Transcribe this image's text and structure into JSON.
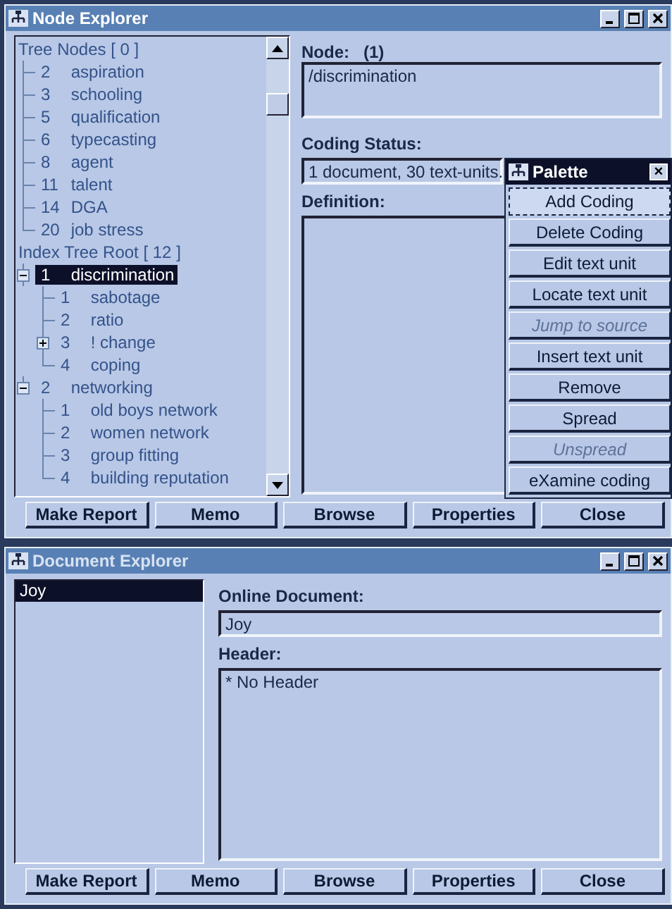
{
  "node_explorer": {
    "title": "Node Explorer",
    "tree": [
      {
        "label": "Tree Nodes [ 0 ]",
        "children": [
          {
            "number": "2",
            "label": "aspiration",
            "selected": false
          },
          {
            "number": "3",
            "label": "schooling",
            "selected": false
          },
          {
            "number": "5",
            "label": "qualification",
            "selected": false
          },
          {
            "number": "6",
            "label": "typecasting",
            "selected": false
          },
          {
            "number": "8",
            "label": "agent",
            "selected": false
          },
          {
            "number": "11",
            "label": "talent",
            "selected": false
          },
          {
            "number": "14",
            "label": "DGA",
            "selected": false
          },
          {
            "number": "20",
            "label": "job stress",
            "selected": false
          }
        ]
      },
      {
        "label": "Index Tree Root [ 12 ]",
        "children": [
          {
            "number": "1",
            "label": "discrimination",
            "selected": true,
            "expanded": true,
            "children": [
              {
                "number": "1",
                "label": "sabotage",
                "selected": false
              },
              {
                "number": "2",
                "label": "ratio",
                "selected": false
              },
              {
                "number": "3",
                "label": "! change",
                "selected": false,
                "expanded": false
              },
              {
                "number": "4",
                "label": "coping",
                "selected": false
              }
            ]
          },
          {
            "number": "2",
            "label": "networking",
            "selected": false,
            "expanded": true,
            "children": [
              {
                "number": "1",
                "label": "old boys network",
                "selected": false
              },
              {
                "number": "2",
                "label": "women network",
                "selected": false
              },
              {
                "number": "3",
                "label": "group fitting",
                "selected": false
              },
              {
                "number": "4",
                "label": "building reputation",
                "selected": false
              }
            ]
          }
        ]
      }
    ],
    "node_label": "Node:",
    "node_number": "(1)",
    "node_value": "/discrimination",
    "coding_status_label": "Coding Status:",
    "coding_status_value": "1 document, 30 text-units.",
    "definition_label": "Definition:",
    "buttons": [
      "Make Report",
      "Memo",
      "Browse",
      "Properties",
      "Close"
    ]
  },
  "palette": {
    "title": "Palette",
    "close": "×",
    "buttons": [
      {
        "label": "Add Coding",
        "disabled": false,
        "focused": true
      },
      {
        "label": "Delete Coding",
        "disabled": false,
        "focused": false
      },
      {
        "label": "Edit text unit",
        "disabled": false,
        "focused": false
      },
      {
        "label": "Locate text unit",
        "disabled": false,
        "focused": false
      },
      {
        "label": "Jump to source",
        "disabled": true,
        "focused": false
      },
      {
        "label": "Insert text unit",
        "disabled": false,
        "focused": false
      },
      {
        "label": "Remove",
        "disabled": false,
        "focused": false
      },
      {
        "label": "Spread",
        "disabled": false,
        "focused": false
      },
      {
        "label": "Unspread",
        "disabled": true,
        "focused": false
      },
      {
        "label": "eXamine coding",
        "disabled": false,
        "focused": false
      }
    ]
  },
  "document_explorer": {
    "title": "Document Explorer",
    "documents": [
      {
        "label": "Joy",
        "selected": true
      }
    ],
    "online_document_label": "Online Document:",
    "online_document_value": "Joy",
    "header_label": "Header:",
    "header_value": "* No Header",
    "buttons": [
      "Make Report",
      "Memo",
      "Browse",
      "Properties",
      "Close"
    ]
  }
}
